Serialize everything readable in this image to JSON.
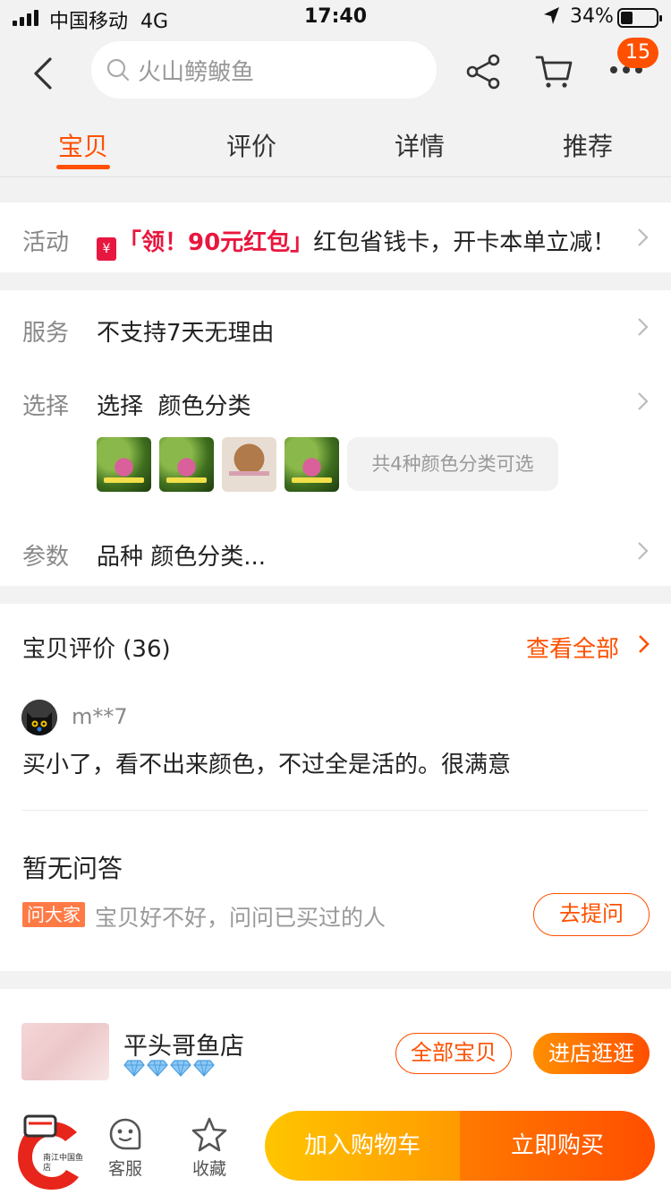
{
  "status_bar": {
    "carrier": "中国移动",
    "network": "4G",
    "time": "17:40",
    "battery_percent": "34%",
    "battery_level": 0.34
  },
  "nav": {
    "search_placeholder": "火山鳑鲏鱼",
    "message_count": "15"
  },
  "tabs": [
    {
      "label": "宝贝",
      "active": true
    },
    {
      "label": "评价",
      "active": false
    },
    {
      "label": "详情",
      "active": false
    },
    {
      "label": "推荐",
      "active": false
    }
  ],
  "activity": {
    "label": "活动",
    "icon_text": "¥",
    "promo_red": "「领！90元红包」",
    "promo_text": "红包省钱卡，开卡本单立减！"
  },
  "service": {
    "label": "服务",
    "value": "不支持7天无理由"
  },
  "select": {
    "label": "选择",
    "value": "选择  颜色分类",
    "more_options": "共4种颜色分类可选"
  },
  "params": {
    "label": "参数",
    "value": "品种 颜色分类..."
  },
  "reviews": {
    "title": "宝贝评价 (36)",
    "see_all": "查看全部",
    "items": [
      {
        "user": "m**7",
        "text": "买小了，看不出来颜色，不过全是活的。很满意"
      }
    ]
  },
  "qa": {
    "title": "暂无问答",
    "badge": "问大家",
    "hint": "宝贝好不好，问问已买过的人",
    "ask_button": "去提问"
  },
  "shop": {
    "name": "平头哥鱼店",
    "diamonds": 4,
    "all_items_button": "全部宝贝",
    "enter_button": "进店逛逛"
  },
  "bottom_bar": {
    "store_icon_text_1": "南江中国鱼",
    "store_icon_text_2": "店",
    "customer_service": "客服",
    "favorite": "收藏",
    "add_to_cart": "加入购物车",
    "buy_now": "立即购买"
  },
  "colors": {
    "accent": "#ff5000",
    "promo_red": "#e8173f",
    "cart_button": "#ffb300",
    "buy_button": "#ff5a00"
  }
}
